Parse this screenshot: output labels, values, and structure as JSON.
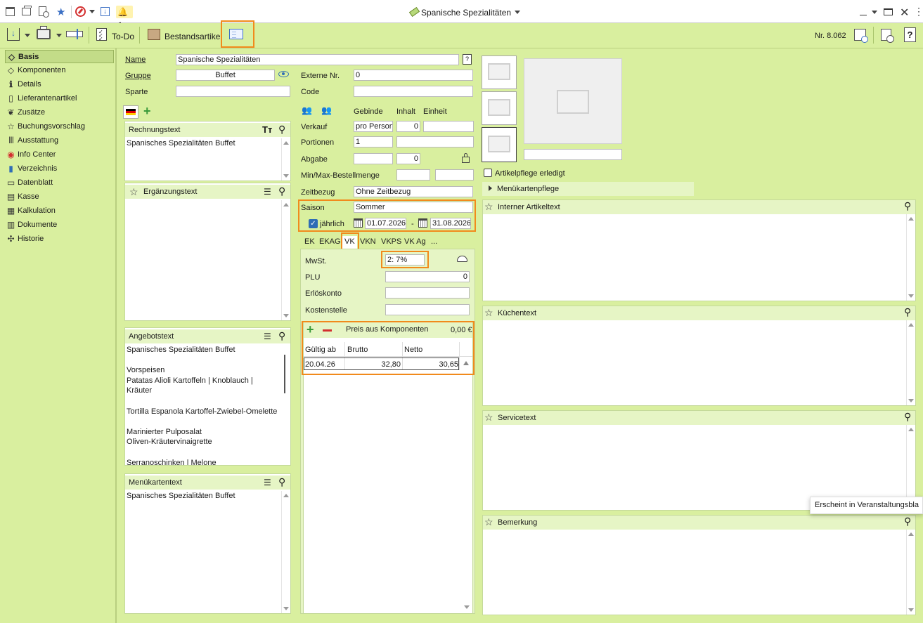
{
  "window": {
    "title": "Spanische Spezialitäten",
    "notification_count": "1"
  },
  "toolbar": {
    "todo_label": "To-Do",
    "bestand_label": "Bestandsartikel",
    "article_number": "Nr. 8.062"
  },
  "sidebar": {
    "items": [
      {
        "label": "Basis",
        "icon": "tag-icon"
      },
      {
        "label": "Komponenten",
        "icon": "tag-icon"
      },
      {
        "label": "Details",
        "icon": "info-icon"
      },
      {
        "label": "Lieferantenartikel",
        "icon": "document-icon"
      },
      {
        "label": "Zusätze",
        "icon": "leaf-icon"
      },
      {
        "label": "Buchungsvorschlag",
        "icon": "star-icon"
      },
      {
        "label": "Ausstattung",
        "icon": "barcode-icon"
      },
      {
        "label": "Info Center",
        "icon": "compass-icon"
      },
      {
        "label": "Verzeichnis",
        "icon": "book-icon"
      },
      {
        "label": "Datenblatt",
        "icon": "sheet-icon"
      },
      {
        "label": "Kasse",
        "icon": "register-icon"
      },
      {
        "label": "Kalkulation",
        "icon": "table-icon"
      },
      {
        "label": "Dokumente",
        "icon": "documents-icon"
      },
      {
        "label": "Historie",
        "icon": "puzzle-icon"
      }
    ]
  },
  "form": {
    "name_label": "Name",
    "name_value": "Spanische Spezialitäten",
    "gruppe_label": "Gruppe",
    "gruppe_value": "Buffet",
    "sparte_label": "Sparte",
    "sparte_value": "",
    "externe_label": "Externe Nr.",
    "externe_value": "0",
    "code_label": "Code",
    "code_value": "",
    "col_gebinde": "Gebinde",
    "col_inhalt": "Inhalt",
    "col_einheit": "Einheit",
    "verkauf_label": "Verkauf",
    "verkauf_gebinde": "pro Person",
    "verkauf_inhalt": "0",
    "verkauf_einheit": "",
    "portionen_label": "Portionen",
    "portionen_value": "1",
    "abgabe_label": "Abgabe",
    "abgabe_inhalt": "0",
    "minmax_label": "Min/Max-Bestellmenge",
    "zeitbezug_label": "Zeitbezug",
    "zeitbezug_value": "Ohne Zeitbezug",
    "saison_label": "Saison",
    "saison_value": "Sommer",
    "jaehrlich_label": "jährlich",
    "date_from": "01.07.2026",
    "date_sep": "-",
    "date_to": "31.08.2026"
  },
  "tabs": [
    "EK",
    "EKAG",
    "VK",
    "VKN",
    "VKPS",
    "VK Ag",
    "..."
  ],
  "vk": {
    "mwst_label": "MwSt.",
    "mwst_value": "2: 7%",
    "plu_label": "PLU",
    "plu_value": "0",
    "erloes_label": "Erlöskonto",
    "kosten_label": "Kostenstelle",
    "preis_label": "Preis aus Komponenten",
    "preis_value": "0,00 €",
    "col_gueltig": "Gültig ab",
    "col_brutto": "Brutto",
    "col_netto": "Netto",
    "row_date": "20.04.26",
    "row_brutto": "32,80",
    "row_netto": "30,65"
  },
  "texts": {
    "rechnung_title": "Rechnungstext",
    "rechnung_body": "Spanisches Spezialitäten Buffet",
    "ergaenzung_title": "Ergänzungstext",
    "angebot_title": "Angebotstext",
    "angebot_lines": [
      "Spanisches Spezialitäten Buffet",
      "",
      "",
      "Vorspeisen",
      "Patatas Alioli Kartoffeln | Knoblauch |",
      "Kräuter",
      "",
      "",
      "Tortilla Espanola Kartoffel-Zwiebel-Omelette",
      "",
      "",
      "Marinierter Pulposalat",
      "Oliven-Kräutervinaigrette",
      "",
      "",
      "Serranoschinken | Melone"
    ],
    "menu_title": "Menükartentext",
    "menu_body": "Spanisches Spezialitäten Buffet"
  },
  "right": {
    "artikelpflege_label": "Artikelpflege erledigt",
    "menuepflege_label": "Menükartenpflege",
    "intern_title": "Interner Artikeltext",
    "kuechen_title": "Küchentext",
    "service_title": "Servicetext",
    "bemerkung_title": "Bemerkung",
    "tooltip": "Erscheint in Veranstaltungsbla"
  },
  "colors": {
    "accent": "#f18a1c",
    "background": "#d9ef9f",
    "panel_header": "#e6f5c5"
  }
}
